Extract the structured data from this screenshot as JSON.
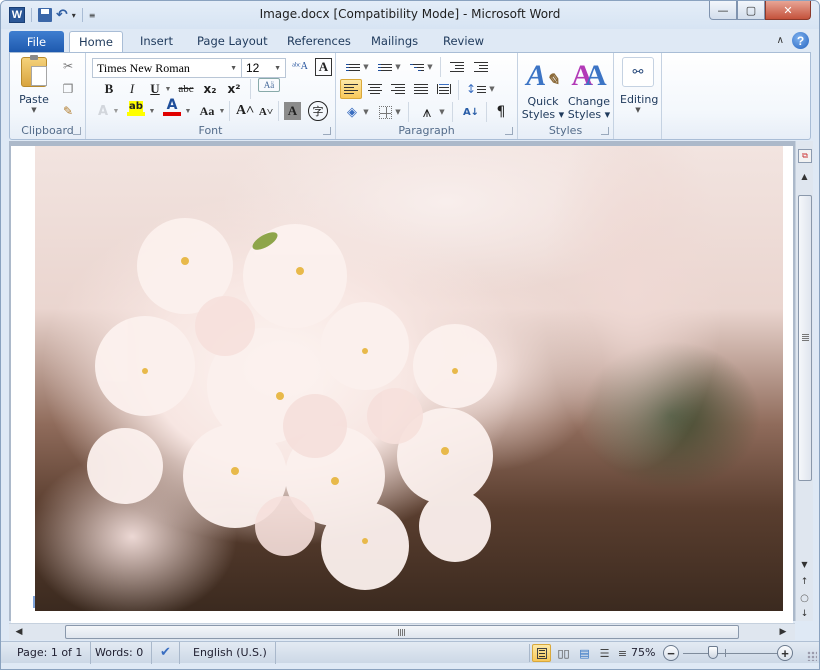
{
  "window": {
    "title": "Image.docx [Compatibility Mode]  -  Microsoft Word",
    "app_icon": "W",
    "controls": {
      "minimize": "minimize-icon",
      "maximize": "maximize-icon",
      "close": "close-icon"
    },
    "min_glyph": "—",
    "max_glyph": "▢",
    "close_glyph": "✕"
  },
  "quick_access": {
    "items": [
      "save-icon",
      "undo-icon",
      "undo-dropdown",
      "customize-toolbar"
    ],
    "undo_glyph": "↶",
    "dd_glyph": "▾",
    "customize_glyph": "≡"
  },
  "tabs": [
    {
      "label": "File"
    },
    {
      "label": "Home",
      "active": true
    },
    {
      "label": "Insert"
    },
    {
      "label": "Page Layout"
    },
    {
      "label": "References"
    },
    {
      "label": "Mailings"
    },
    {
      "label": "Review"
    }
  ],
  "ribbon_controls": {
    "collapse_glyph": "∧",
    "help_glyph": "?"
  },
  "ribbon": {
    "clipboard": {
      "label": "Clipboard",
      "paste_label": "Paste",
      "cut_glyph": "✂",
      "copy_glyph": "❐",
      "format_painter_glyph": "🖌"
    },
    "font": {
      "label": "Font",
      "font_name": "Times New Roman",
      "font_size": "12",
      "bold": "B",
      "italic": "I",
      "underline": "U",
      "strikethrough": "abc",
      "subscript": "x₂",
      "superscript": "x²",
      "change_case": "Aa",
      "grow_font": "A˄",
      "shrink_font": "A˅",
      "text_effects": "A",
      "highlight": "ab",
      "font_color": "A",
      "char_shading": "A",
      "enclose_chars": "字",
      "highlight_color": "#ffff00",
      "font_color_value": "#e00000"
    },
    "paragraph": {
      "label": "Paragraph",
      "sort_glyph": "A↓",
      "pilcrow": "¶",
      "line_spacing_glyph": "↕"
    },
    "styles": {
      "label": "Styles",
      "quick_styles_l1": "Quick",
      "quick_styles_l2": "Styles ▾",
      "change_styles_l1": "Change",
      "change_styles_l2": "Styles ▾"
    },
    "editing": {
      "label": "Editing",
      "glyph": "⚉"
    }
  },
  "status_bar": {
    "page": "Page: 1 of 1",
    "words": "Words: 0",
    "language": "English (U.S.)",
    "zoom": "75%",
    "zoom_minus": "−",
    "zoom_plus": "+",
    "zoom_level_percent": 75,
    "proofing_glyph": "✔"
  },
  "scroll": {
    "up_glyph": "▲",
    "down_glyph": "▼",
    "prev_page_glyph": "↑",
    "browse_glyph": "○",
    "next_page_glyph": "↓",
    "left_glyph": "◀",
    "right_glyph": "▶"
  },
  "document": {
    "image_alt": "Cherry blossom photograph"
  }
}
